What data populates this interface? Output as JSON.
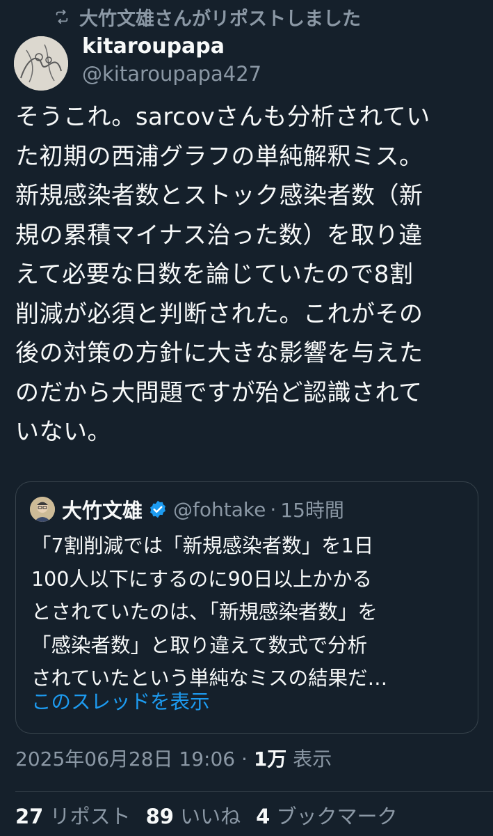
{
  "repost_banner": {
    "text": "大竹文雄さんがリポストしました",
    "icon": "repost-icon"
  },
  "author": {
    "display_name": "kitaroupapa",
    "handle": "@kitaroupapa427",
    "avatar_icon": "avatar"
  },
  "tweet": {
    "text": "そうこれ。sarcovさんも分析されてい\nた初期の西浦グラフの単純解釈ミス。\n新規感染者数とストック感染者数（新\n規の累積マイナス治った数）を取り違\nえて必要な日数を論じていたので8割\n削減が必須と判断された。これがその\n後の対策の方針に大きな影響を与えた\nのだから大問題ですが殆ど認識されて\nいない。"
  },
  "quote": {
    "name": "大竹文雄",
    "verified_icon": "verified-badge-icon",
    "handle": "@fohtake",
    "separator": "·",
    "time": "15時間",
    "text": "「7割削減では「新規感染者数」を1日\n100人以下にするのに90日以上かかる\nとされていたのは、「新規感染者数」を\n「感染者数」と取り違えて数式で分析\nされていたという単純なミスの結果だ…",
    "show_thread": "このスレッドを表示"
  },
  "meta": {
    "timestamp": "2025年06月28日 19:06",
    "separator": " · ",
    "views_count": "1万",
    "views_label": " 表示"
  },
  "stats": {
    "reposts_count": "27",
    "reposts_label": " リポスト",
    "likes_count": "89",
    "likes_label": " いいね",
    "bookmarks_count": "4",
    "bookmarks_label": " ブックマーク"
  },
  "colors": {
    "background": "#15202b",
    "text": "#f7f9f9",
    "secondary": "#8b98a5",
    "link": "#1d9bf0",
    "border": "#38444d"
  }
}
